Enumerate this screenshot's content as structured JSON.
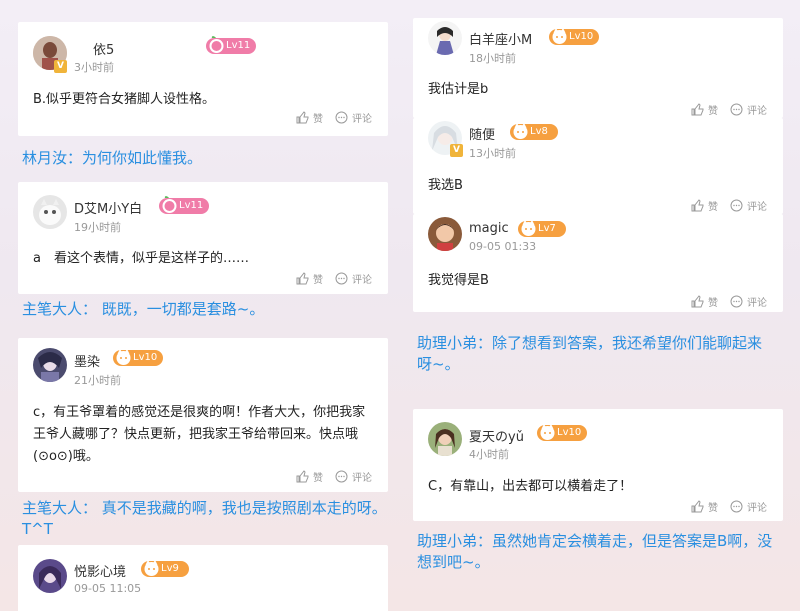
{
  "cards": [
    {
      "id": "c1",
      "user": "依5",
      "level": "Lv11",
      "time": "3小时前",
      "text": "B.似乎更符合女猪脚人设性格。",
      "like": "赞",
      "comment": "评论"
    },
    {
      "id": "c2",
      "user": "D艾M小Y白",
      "level": "Lv11",
      "time": "19小时前",
      "text": "a　看这个表情，似乎是这样子的……",
      "like": "赞",
      "comment": "评论"
    },
    {
      "id": "c3",
      "user": "墨染",
      "level": "Lv10",
      "time": "21小时前",
      "text": "c，有王爷罩着的感觉还是很爽的啊！作者大大，你把我家王爷人藏哪了？快点更新，把我家王爷给带回来。快点哦(⊙o⊙)哦。",
      "like": "赞",
      "comment": "评论"
    },
    {
      "id": "c4",
      "user": "悦影心境",
      "level": "Lv9",
      "time": "09-05 11:05"
    },
    {
      "id": "c5",
      "user": "白羊座小M",
      "level": "Lv10",
      "time": "18小时前",
      "text": "我估计是b",
      "like": "赞",
      "comment": "评论"
    },
    {
      "id": "c6",
      "user": "随便",
      "level": "Lv8",
      "time": "13小时前",
      "text": "我选B",
      "like": "赞",
      "comment": "评论"
    },
    {
      "id": "c7",
      "user": "magic",
      "level": "Lv7",
      "time": "09-05 01:33",
      "text": "我觉得是B",
      "like": "赞",
      "comment": "评论"
    },
    {
      "id": "c8",
      "user": "夏天のyǔ",
      "level": "Lv10",
      "time": "4小时前",
      "text": "C，有靠山，出去都可以横着走了！",
      "like": "赞",
      "comment": "评论"
    }
  ],
  "replies": {
    "r1": "林月汝：为何你如此懂我。",
    "r2": "主笔大人： 既既，一切都是套路~。",
    "r3": "主笔大人： 真不是我藏的啊，我也是按照剧本走的呀。T^T",
    "r4": "助理小弟：除了想看到答案，我还希望你们能聊起来呀~。",
    "r5": "助理小弟：虽然她肯定会横着走，但是答案是B啊，没想到吧~。"
  },
  "colors": {
    "reply_blue": "#2a8fe0",
    "level_pink": "#f07ca8",
    "level_orange": "#f6a040"
  }
}
